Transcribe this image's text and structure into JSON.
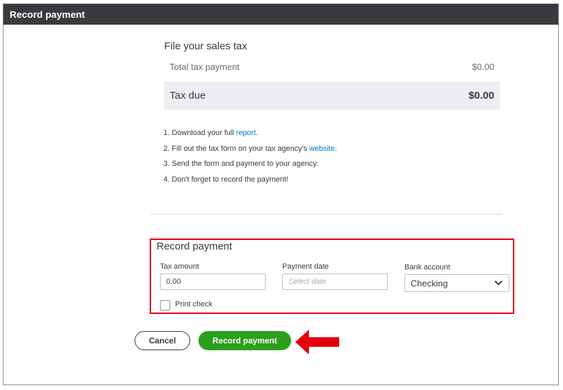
{
  "window": {
    "title": "Record payment"
  },
  "summary": {
    "heading": "File your sales tax",
    "total_label": "Total tax payment",
    "total_value": "$0.00",
    "due_label": "Tax due",
    "due_value": "$0.00"
  },
  "steps": {
    "s1_prefix": "1. Download your full ",
    "s1_link": "report",
    "s1_suffix": ".",
    "s2_prefix": "2. Fill out the tax form on your tax agency's ",
    "s2_link": "website",
    "s2_suffix": ".",
    "s3": "3. Send the form and payment to your agency.",
    "s4": "4. Don't forget to record the payment!"
  },
  "form": {
    "title": "Record payment",
    "tax_amount_label": "Tax amount",
    "tax_amount_value": "0.00",
    "payment_date_label": "Payment date",
    "payment_date_placeholder": "Select date",
    "bank_account_label": "Bank account",
    "bank_account_value": "Checking",
    "print_check_label": "Print check"
  },
  "buttons": {
    "cancel": "Cancel",
    "record": "Record payment"
  },
  "colors": {
    "titlebar": "#393a3d",
    "link": "#0077c5",
    "primary": "#2ca01c",
    "highlight": "#e3000f"
  }
}
